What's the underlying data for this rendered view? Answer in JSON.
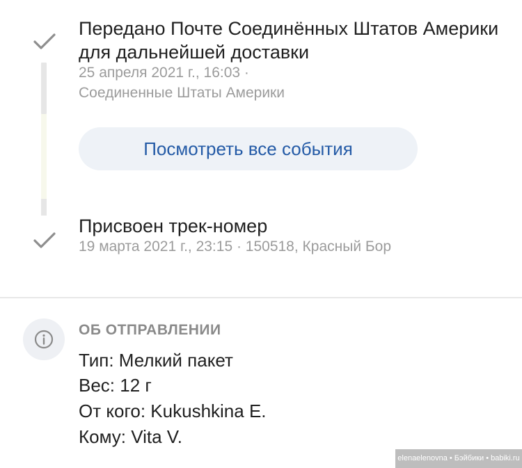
{
  "events": [
    {
      "title": "Передано Почте Соединённых Штатов Америки для дальнейшей доставки",
      "date": "25 апреля 2021 г., 16:03 ·",
      "location": "Соединенные Штаты Америки"
    },
    {
      "title": "Присвоен трек-номер",
      "meta": "19 марта 2021 г., 23:15 · 150518, Красный Бор"
    }
  ],
  "view_all_button": "Посмотреть все события",
  "about": {
    "header": "ОБ ОТПРАВЛЕНИИ",
    "type": "Тип: Мелкий пакет",
    "weight": "Вес: 12 г",
    "from": "От кого: Kukushkina E.",
    "to": "Кому: Vita V."
  },
  "watermark": "elenaelenovna • Бэйбики • babiki.ru",
  "colors": {
    "accent": "#235aa6",
    "button_bg": "#eef2f7",
    "secondary_text": "#9b9b9b",
    "check": "#8e8e8e"
  },
  "icons": [
    "check-icon",
    "check-icon",
    "info-icon"
  ]
}
